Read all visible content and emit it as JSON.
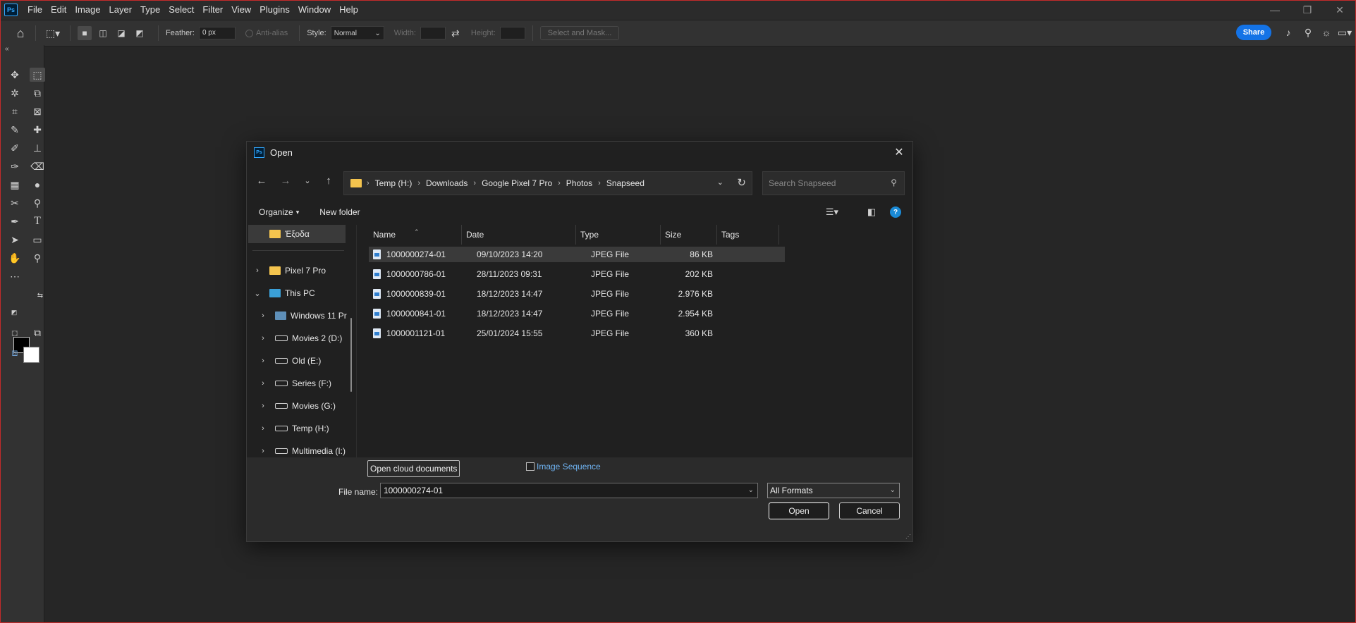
{
  "app": {
    "logo": "Ps",
    "menu": [
      "File",
      "Edit",
      "Image",
      "Layer",
      "Type",
      "Select",
      "Filter",
      "View",
      "Plugins",
      "Window",
      "Help"
    ],
    "window_controls": {
      "minimize": "—",
      "restore": "❐",
      "close": "✕"
    }
  },
  "options_bar": {
    "feather_label": "Feather:",
    "feather_value": "0 px",
    "anti_alias_label": "Anti-alias",
    "style_label": "Style:",
    "style_value": "Normal",
    "width_label": "Width:",
    "height_label": "Height:",
    "select_mask_label": "Select and Mask...",
    "share_label": "Share"
  },
  "dialog": {
    "title": "Open",
    "logo": "Ps",
    "address": {
      "crumbs": [
        "Temp (H:)",
        "Downloads",
        "Google Pixel 7 Pro",
        "Photos",
        "Snapseed"
      ]
    },
    "search_placeholder": "Search Snapseed",
    "organize_label": "Organize",
    "new_folder_label": "New folder",
    "help_glyph": "?",
    "nav_items": [
      {
        "label": "Έξοδα",
        "icon": "folder"
      },
      {
        "label": "Pixel 7 Pro",
        "icon": "folder"
      },
      {
        "label": "This PC",
        "icon": "pc"
      },
      {
        "label": "Windows 11 Pr",
        "icon": "drive"
      },
      {
        "label": "Movies 2 (D:)",
        "icon": "drive"
      },
      {
        "label": "Old (E:)",
        "icon": "drive"
      },
      {
        "label": "Series (F:)",
        "icon": "drive"
      },
      {
        "label": "Movies (G:)",
        "icon": "drive"
      },
      {
        "label": "Temp (H:)",
        "icon": "drive"
      },
      {
        "label": "Multimedia (I:)",
        "icon": "drive"
      }
    ],
    "columns": [
      "Name",
      "Date",
      "Type",
      "Size",
      "Tags"
    ],
    "files": [
      {
        "name": "1000000274-01",
        "date": "09/10/2023 14:20",
        "type": "JPEG File",
        "size": "86 KB"
      },
      {
        "name": "1000000786-01",
        "date": "28/11/2023 09:31",
        "type": "JPEG File",
        "size": "202 KB"
      },
      {
        "name": "1000000839-01",
        "date": "18/12/2023 14:47",
        "type": "JPEG File",
        "size": "2.976 KB"
      },
      {
        "name": "1000000841-01",
        "date": "18/12/2023 14:47",
        "type": "JPEG File",
        "size": "2.954 KB"
      },
      {
        "name": "1000001121-01",
        "date": "25/01/2024 15:55",
        "type": "JPEG File",
        "size": "360 KB"
      }
    ],
    "cloud_button": "Open cloud documents",
    "image_sequence_label": "Image Sequence",
    "file_name_label": "File name:",
    "file_name_value": "1000000274-01",
    "format_value": "All Formats",
    "open_label": "Open",
    "cancel_label": "Cancel"
  }
}
